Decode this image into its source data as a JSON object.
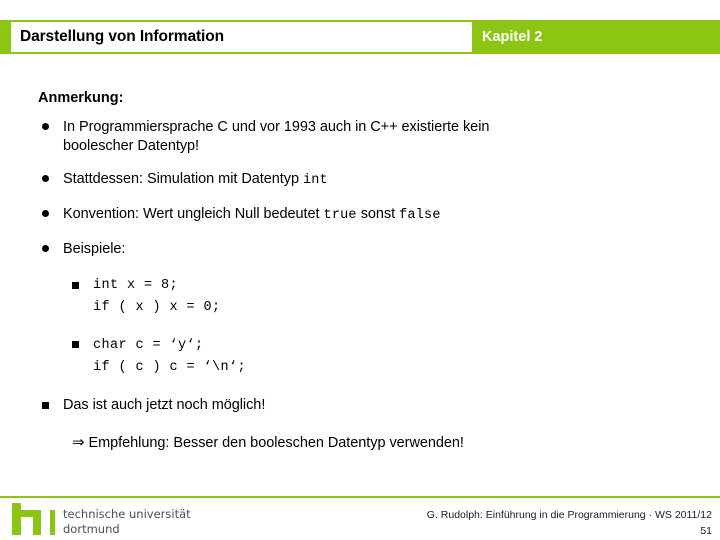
{
  "header": {
    "title": "Darstellung von Information",
    "chapter": "Kapitel 2",
    "accent_color": "#8cc513"
  },
  "content": {
    "section_heading": "Anmerkung:",
    "bullets": [
      {
        "marker": "dot",
        "level": 1,
        "line1_a": "In Programmiersprache C und vor 1993 auch in C++ existierte kein",
        "line2": "boolescher Datentyp!"
      },
      {
        "marker": "dot",
        "level": 1,
        "text_a": "Stattdessen: Simulation mit Datentyp ",
        "code_a": "int"
      },
      {
        "marker": "dot",
        "level": 1,
        "text_a": "Konvention: Wert ungleich Null bedeutet ",
        "code_a": "true",
        "text_b": " sonst ",
        "code_b": "false"
      },
      {
        "marker": "dot",
        "level": 1,
        "text_a": "Beispiele:"
      }
    ],
    "code_examples": [
      {
        "marker": "square",
        "line1": "int x = 8;",
        "line2": "if ( x ) x = 0;"
      },
      {
        "marker": "square",
        "line1": "char c = ‘y‘;",
        "line2": "if ( c ) c = ‘\\n‘;"
      }
    ],
    "closing": {
      "marker": "square",
      "text": "Das ist auch jetzt noch möglich!"
    },
    "recommendation": {
      "arrow": "⇒",
      "text": "Empfehlung: Besser den booleschen Datentyp verwenden!"
    }
  },
  "footer": {
    "logo_mark": "tu-dortmund-logo",
    "logo_line1": "technische universität",
    "logo_line2": "dortmund",
    "credit": "G. Rudolph: Einführung in die Programmierung · WS 2011/12",
    "page_number": "51",
    "rule_color": "#8cc513"
  }
}
